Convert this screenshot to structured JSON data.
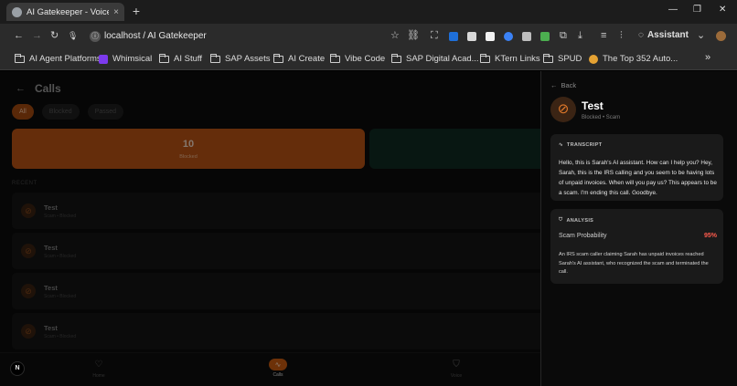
{
  "browser": {
    "tab_title": "AI Gatekeeper - Voice-Powere",
    "tab_close": "×",
    "new_tab": "+",
    "window_controls": {
      "minimize": "—",
      "restore": "❐",
      "close": "✕"
    },
    "nav": {
      "back": "←",
      "forward": "→",
      "reload": "↻",
      "mic": "🎙"
    },
    "url": "localhost / AI Gatekeeper",
    "assistant_label": "Assistant",
    "bookmarks": [
      {
        "label": "AI Agent Platforms"
      },
      {
        "label": "Whimsical"
      },
      {
        "label": "AI Stuff"
      },
      {
        "label": "SAP Assets"
      },
      {
        "label": "AI Create"
      },
      {
        "label": "Vibe Code"
      },
      {
        "label": "SAP Digital Acad..."
      },
      {
        "label": "KTern Links"
      },
      {
        "label": "SPUD"
      },
      {
        "label": "The Top 352 Auto..."
      }
    ],
    "bookmarks_overflow": "»"
  },
  "app": {
    "header_title": "Calls",
    "back_arrow": "←",
    "filters": [
      "All",
      "Blocked",
      "Passed"
    ],
    "stats": [
      {
        "value": "10",
        "label": "Blocked"
      },
      {
        "value": "",
        "label": ""
      }
    ],
    "recent_label": "RECENT",
    "calls": [
      {
        "name": "Test",
        "sub": "Scam • Blocked"
      },
      {
        "name": "Test",
        "sub": "Scam • Blocked"
      },
      {
        "name": "Test",
        "sub": "Scam • Blocked"
      },
      {
        "name": "Test",
        "sub": "Scam • Blocked"
      }
    ],
    "bottom_nav": [
      {
        "label": "Home",
        "icon": "heart-icon"
      },
      {
        "label": "Calls",
        "icon": "activity-icon"
      },
      {
        "label": "Voice",
        "icon": "shield-icon"
      }
    ],
    "n_badge": "N"
  },
  "drawer": {
    "back_label": "Back",
    "title": "Test",
    "subtitle": "Blocked • Scam",
    "transcript_heading": "TRANSCRIPT",
    "transcript": "Hello, this is Sarah's AI assistant. How can I help you? Hey, Sarah, this is the IRS calling and you seem to be having lots of unpaid invoices. When will you pay us? This appears to be a scam. I'm ending this call. Goodbye.",
    "analysis_heading": "ANALYSIS",
    "scam_label": "Scam Probability",
    "scam_value": "95%",
    "summary": "An IRS scam caller claiming Sarah has unpaid invoices reached Sarah's AI assistant, who recognized the scam and terminated the call."
  },
  "colors": {
    "accent_orange": "#b95314",
    "danger_red": "#ff5b4d",
    "panel_bg": "#1a1a1a"
  }
}
